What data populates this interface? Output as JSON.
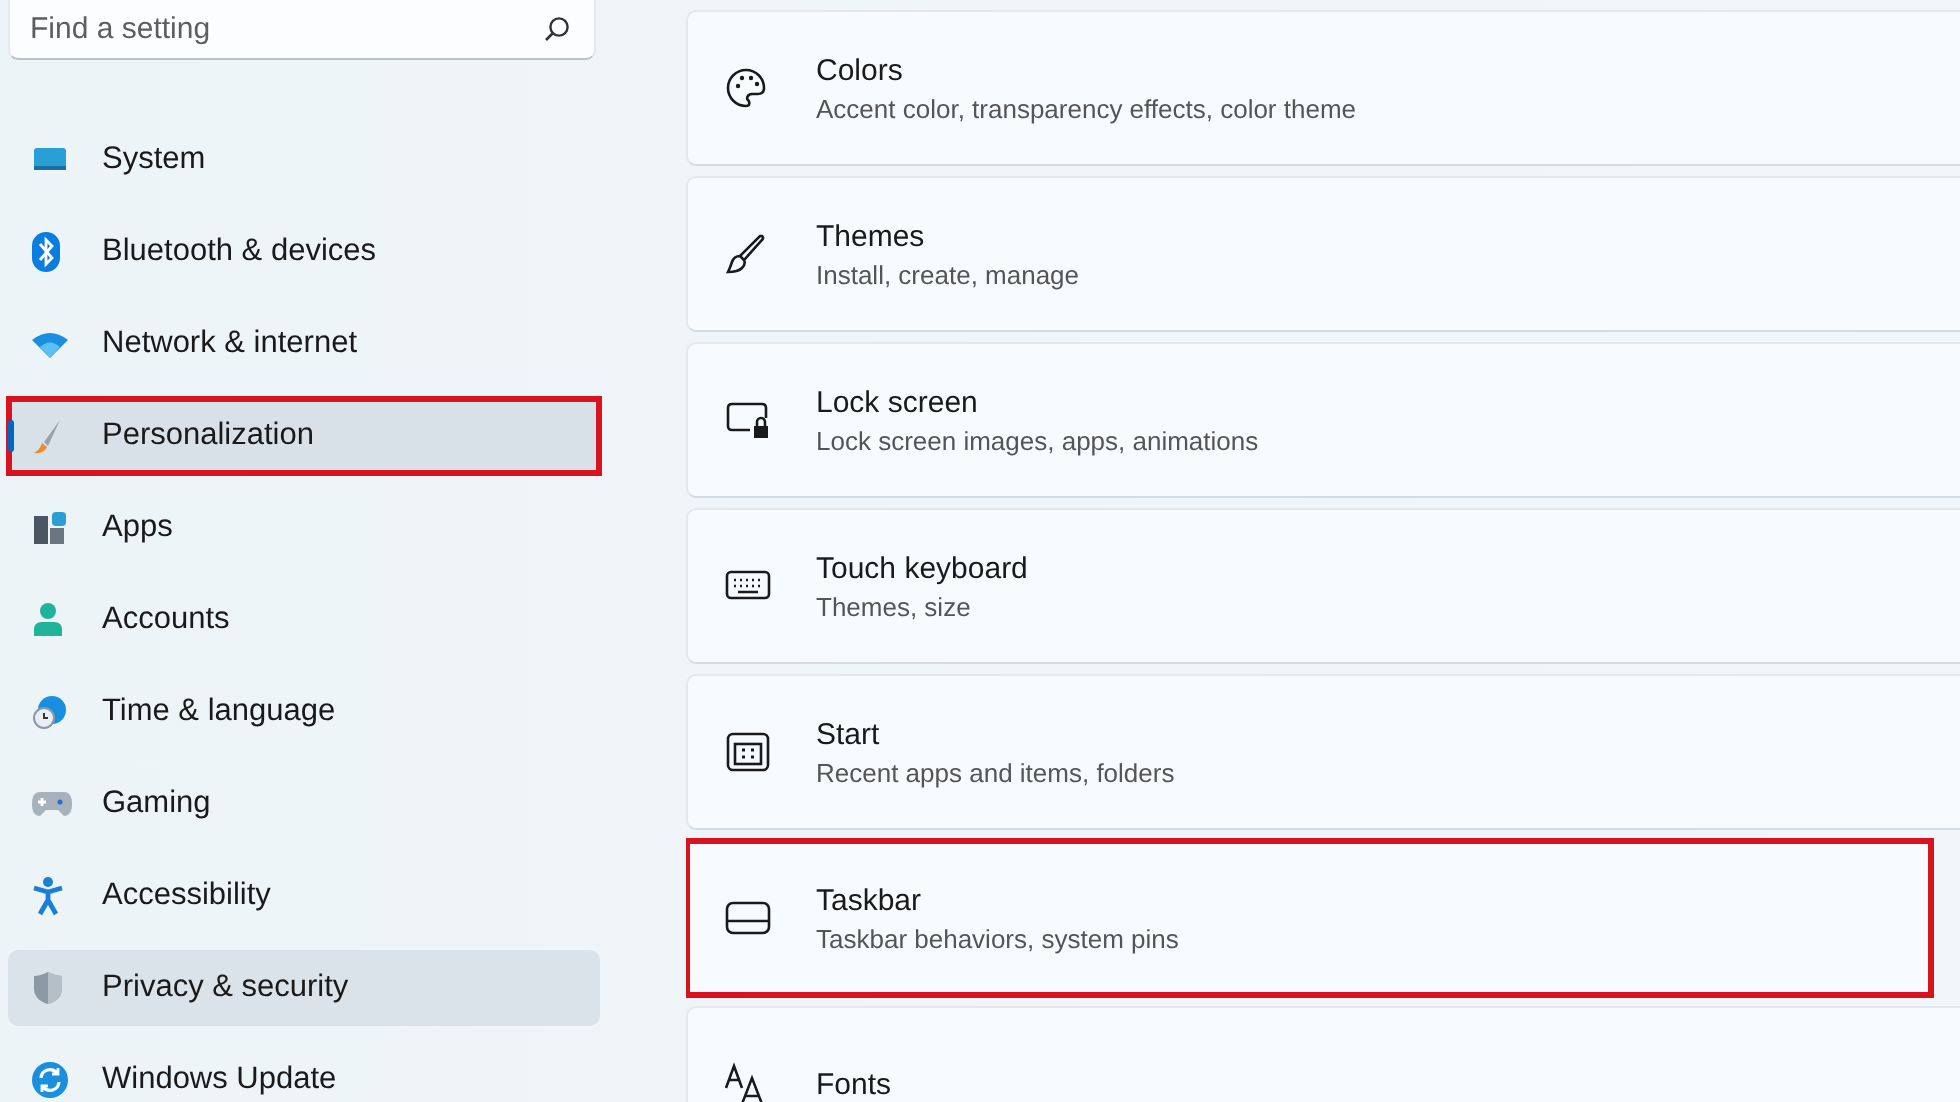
{
  "sidebar": {
    "search": {
      "placeholder": "Find a setting"
    },
    "items": [
      {
        "kind": "system",
        "label": "System",
        "selected": false,
        "hovered": false,
        "highlighted": false
      },
      {
        "kind": "bluetooth",
        "label": "Bluetooth & devices",
        "selected": false,
        "hovered": false,
        "highlighted": false
      },
      {
        "kind": "network",
        "label": "Network & internet",
        "selected": false,
        "hovered": false,
        "highlighted": false
      },
      {
        "kind": "personalization",
        "label": "Personalization",
        "selected": true,
        "hovered": false,
        "highlighted": true
      },
      {
        "kind": "apps",
        "label": "Apps",
        "selected": false,
        "hovered": false,
        "highlighted": false
      },
      {
        "kind": "accounts",
        "label": "Accounts",
        "selected": false,
        "hovered": false,
        "highlighted": false
      },
      {
        "kind": "time",
        "label": "Time & language",
        "selected": false,
        "hovered": false,
        "highlighted": false
      },
      {
        "kind": "gaming",
        "label": "Gaming",
        "selected": false,
        "hovered": false,
        "highlighted": false
      },
      {
        "kind": "accessibility",
        "label": "Accessibility",
        "selected": false,
        "hovered": false,
        "highlighted": false
      },
      {
        "kind": "privacy",
        "label": "Privacy & security",
        "selected": false,
        "hovered": true,
        "highlighted": false
      },
      {
        "kind": "update",
        "label": "Windows Update",
        "selected": false,
        "hovered": false,
        "highlighted": false
      }
    ]
  },
  "cards": [
    {
      "kind": "palette",
      "title": "Colors",
      "subtitle": "Accent color, transparency effects, color theme",
      "highlighted": false
    },
    {
      "kind": "brush",
      "title": "Themes",
      "subtitle": "Install, create, manage",
      "highlighted": false
    },
    {
      "kind": "lock",
      "title": "Lock screen",
      "subtitle": "Lock screen images, apps, animations",
      "highlighted": false
    },
    {
      "kind": "keyboard",
      "title": "Touch keyboard",
      "subtitle": "Themes, size",
      "highlighted": false
    },
    {
      "kind": "start",
      "title": "Start",
      "subtitle": "Recent apps and items, folders",
      "highlighted": false
    },
    {
      "kind": "taskbar",
      "title": "Taskbar",
      "subtitle": "Taskbar behaviors, system pins",
      "highlighted": true
    },
    {
      "kind": "fonts",
      "title": "Fonts",
      "highlighted": false
    }
  ]
}
